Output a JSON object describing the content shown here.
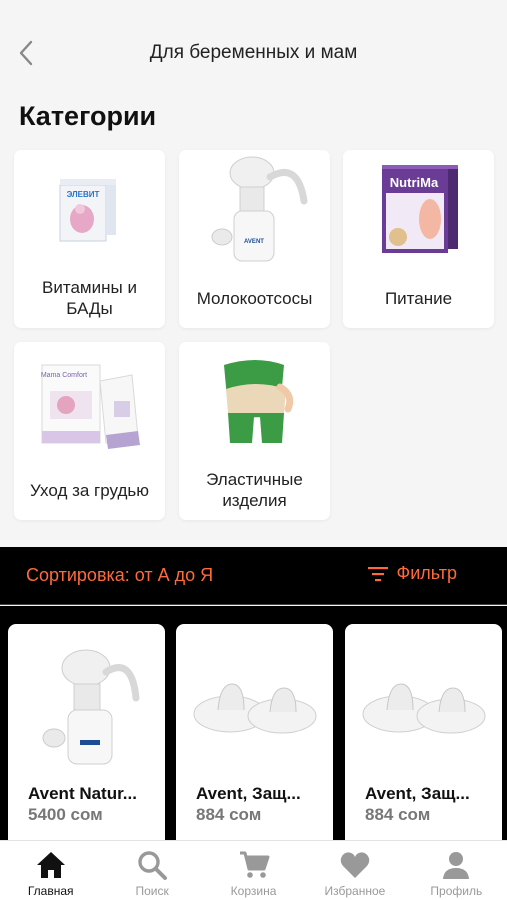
{
  "header": {
    "title": "Для беременных и мам"
  },
  "section_title": "Категории",
  "categories": [
    {
      "label": "Витамины и БАДы",
      "pack_text": "ЭЛЕВИТ"
    },
    {
      "label": "Молокоотсосы",
      "brand": "AVENT"
    },
    {
      "label": "Питание",
      "pack_text": "NutriMa"
    },
    {
      "label": "Уход за грудью",
      "pack_text": "Mama Comfort"
    },
    {
      "label": "Эластичные изделия"
    }
  ],
  "sortbar": {
    "sort_label": "Сортировка: от А до Я",
    "filter_label": "Фильтр"
  },
  "products": [
    {
      "name": "Avent Natur...",
      "price": "5400 сом",
      "image": "breast-pump"
    },
    {
      "name": "Avent, Защ...",
      "price": "884 сом",
      "image": "nipple-shields"
    },
    {
      "name": "Avent, Защ...",
      "price": "884 сом",
      "image": "nipple-shields"
    }
  ],
  "tabs": [
    {
      "label": "Главная",
      "icon": "home-icon",
      "active": true
    },
    {
      "label": "Поиск",
      "icon": "search-icon"
    },
    {
      "label": "Корзина",
      "icon": "cart-icon"
    },
    {
      "label": "Избранное",
      "icon": "heart-icon"
    },
    {
      "label": "Профиль",
      "icon": "profile-icon"
    }
  ],
  "colors": {
    "accent": "#ff6a3a",
    "background": "#f5f5f5",
    "sortbar_bg": "#000000"
  }
}
